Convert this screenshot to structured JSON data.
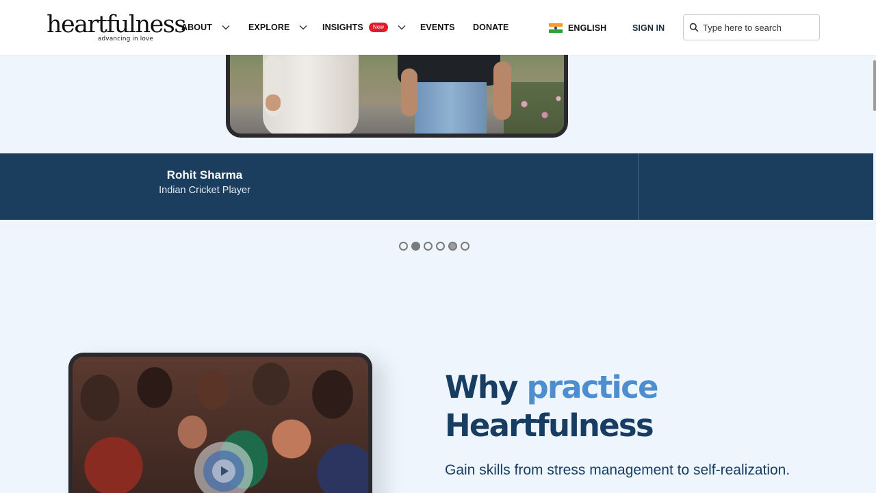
{
  "header": {
    "logo_text": "heartfulness",
    "logo_tagline": "advancing in love",
    "nav": [
      {
        "label": "ABOUT"
      },
      {
        "label": "EXPLORE"
      },
      {
        "label": "INSIGHTS",
        "badge": "New"
      },
      {
        "label": "EVENTS"
      },
      {
        "label": "DONATE"
      }
    ],
    "language": "ENGLISH",
    "sign_in": "SIGN IN",
    "search_placeholder": "Type here to search"
  },
  "testimonial": {
    "name": "Rohit Sharma",
    "role": "Indian Cricket Player"
  },
  "carousel": {
    "dot_count": 6,
    "active_index": 1
  },
  "why_section": {
    "title_part1": "Why",
    "title_accent": "practice",
    "title_part2": "Heartfulness",
    "subtitle": "Gain skills from stress management to self-realization."
  },
  "colors": {
    "brand_navy": "#1b3d5e",
    "accent_blue": "#4d8ed0",
    "new_badge": "#e41d25",
    "page_bg": "#eef5fd"
  }
}
